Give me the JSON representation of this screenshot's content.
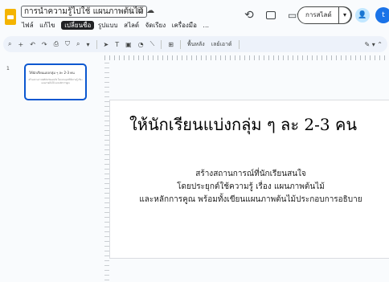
{
  "app": {
    "doc_title": "การนำความรู้ไปใช้ แผนภาพต้นไม้",
    "menu": [
      "ไฟล์",
      "แก้ไข",
      "มุมมอง",
      "แทรก",
      "รูปแบบ",
      "สไลด์",
      "จัดเรียง",
      "เครื่องมือ",
      "..."
    ],
    "menu_tooltip": "เปลี่ยนชื่อ",
    "slideshow_label": "การสไลด์",
    "avatar_letter": "t"
  },
  "toolbar": {
    "background_label": "พื้นหลัง",
    "layout_label": "เลย์เอาต์"
  },
  "filmstrip": {
    "slide_number": "1",
    "thumb_title": "ให้นักเรียนแบ่งกลุ่ม ๆ ละ 2-3 คน",
    "thumb_sub": "สร้างสถานการณ์ที่นักเรียนสนใจ โดยประยุกต์ใช้ความรู้ เรื่อง แผนภาพต้นไม้ และหลักการคูณ"
  },
  "slide": {
    "title": "ให้นักเรียนแบ่งกลุ่ม ๆ ละ 2-3 คน",
    "body_lines": [
      "สร้างสถานการณ์ที่นักเรียนสนใจ",
      "โดยประยุกต์ใช้ความรู้ เรื่อง แผนภาพต้นไม้",
      "และหลักการคูณ พร้อมทั้งเขียนแผนภาพต้นไม้ประกอบการอธิบาย"
    ]
  },
  "colors": {
    "accent": "#0b57d0",
    "logo": "#f4b400",
    "toolbar_bg": "#edf2fa"
  }
}
